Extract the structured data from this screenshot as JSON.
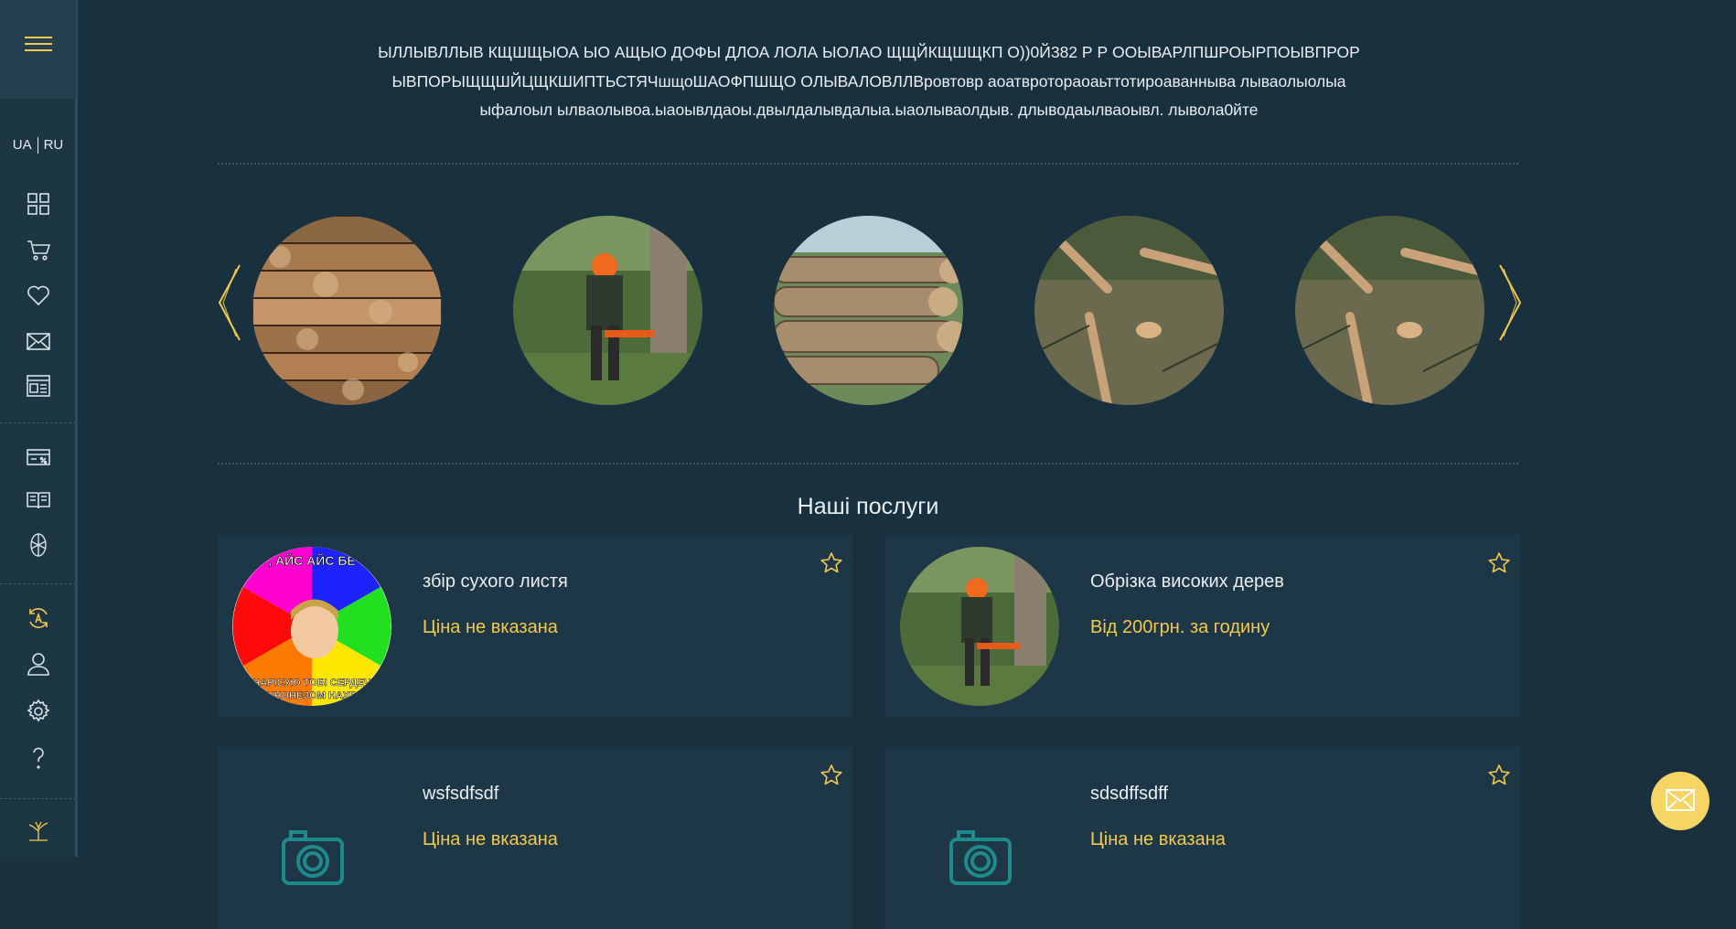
{
  "colors": {
    "background": "#19303f",
    "sidebar": "#1d3644",
    "card": "#1e3746",
    "accent": "#f2c94c",
    "icon": "#d8e1e6"
  },
  "sidebar": {
    "lang_ua": "UA",
    "lang_ru": "RU",
    "icons": [
      "grid-icon",
      "cart-icon",
      "heart-icon",
      "envelope-icon",
      "news-icon",
      "discount-card-icon",
      "book-icon",
      "pie-icon",
      "refresh-icon",
      "user-icon",
      "gear-icon",
      "question-icon",
      "tree-logo-icon"
    ]
  },
  "intro": {
    "line1": "ЫЛЛЫВЛЛЫВ КЩШЩЫОА ЫО АЩЫО ДОФЫ ДЛОА ЛОЛА ЫОЛАО ЩЩЙКЩШЩКП О))0Й382 Р Р ООЫВАРЛПШРОЫРПОЫВПРОР",
    "line2": "ЫВПОРЫЩЩШЙЦЩКШИПТЬСТЯЧшщоШАОФПШЩО ОЛЫВАЛОВЛЛВровтовр аоатвротораоаьттотироаванныва лываолыолыа",
    "line3": "ыфалоыл ылваолывоа.ыаоывлдаоы.двылдалывдалыа.ыаолываолдыв. длыводаылваоывл. лывола0йте"
  },
  "carousel": {
    "items": [
      "firewood-photo",
      "lumberjack-photo",
      "logs-photo",
      "felled-trees-photo",
      "felled-trees-photo-2"
    ]
  },
  "services": {
    "title": "Наші послуги",
    "cards": [
      {
        "name": "збір сухого листя",
        "price": "Ціна не вказана",
        "image": "meme-photo"
      },
      {
        "name": "Обрізка високих дерев",
        "price": "Від 200грн. за годину",
        "image": "lumberjack-photo"
      },
      {
        "name": "wsfsdfsdf",
        "price": "Ціна не вказана",
        "image": "camera-placeholder"
      },
      {
        "name": "sdsdffsdff",
        "price": "Ціна не вказана",
        "image": "camera-placeholder"
      }
    ],
    "meme_top_text": ", АЙС АЙС БЕ",
    "meme_bottom_text1": "НАРІСУЮ ТОБІ СЕРДЕЧ",
    "meme_bottom_text2": "ЧНОНЕЗОМ НАХВ"
  }
}
